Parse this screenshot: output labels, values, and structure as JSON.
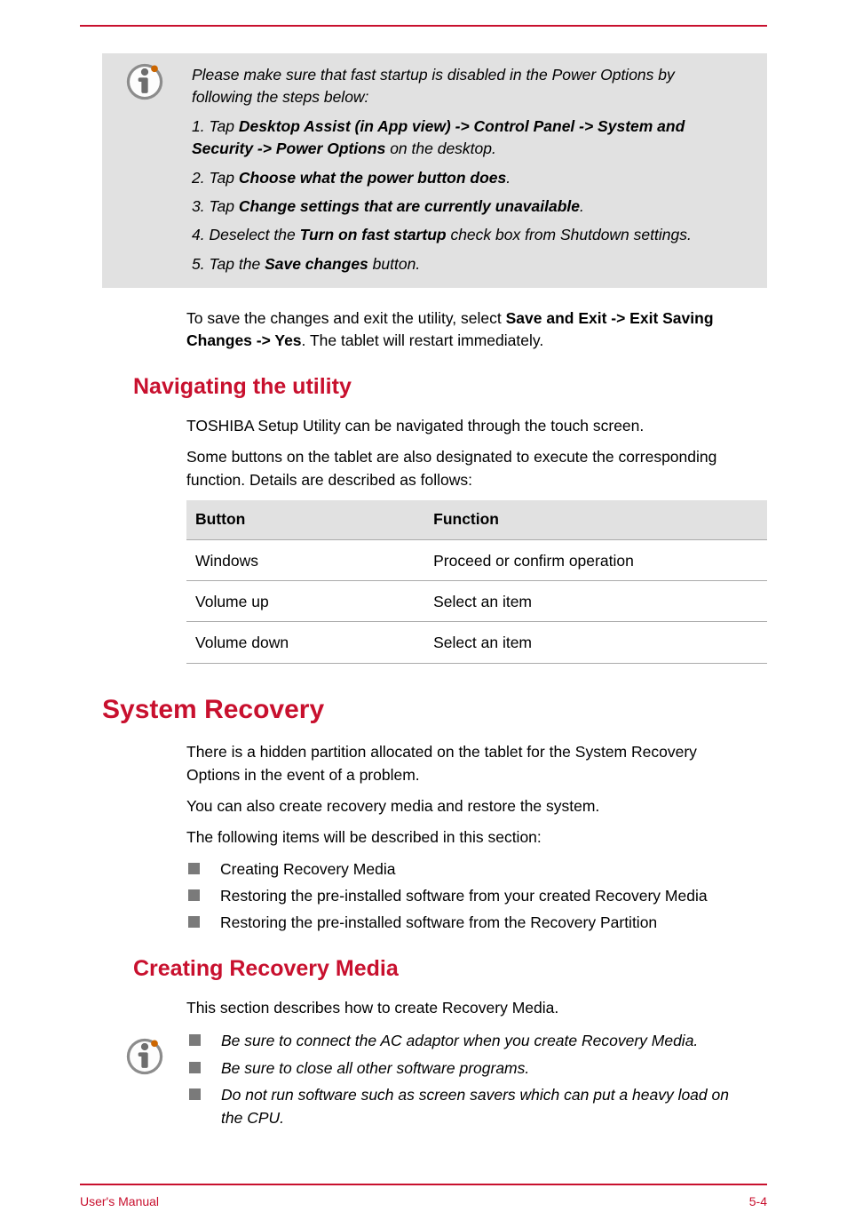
{
  "note1": {
    "intro": "Please make sure that fast startup is disabled in the Power Options by following the steps below:",
    "step1_pre": "1. Tap ",
    "step1_bold": "Desktop Assist (in App view) -> Control Panel -> System and Security -> Power Options",
    "step1_post": " on the desktop.",
    "step2_pre": "2. Tap ",
    "step2_bold": "Choose what the power button does",
    "step2_post": ".",
    "step3_pre": "3. Tap ",
    "step3_bold": "Change settings that are currently unavailable",
    "step3_post": ".",
    "step4_pre": "4. Deselect the ",
    "step4_bold": "Turn on fast startup",
    "step4_post": " check box from Shutdown settings.",
    "step5_pre": "5. Tap the ",
    "step5_bold": "Save changes",
    "step5_post": " button."
  },
  "save_exit": {
    "pre": "To save the changes and exit the utility, select ",
    "bold1": "Save and Exit -> Exit Saving Changes -> Yes",
    "post": ". The tablet will restart immediately."
  },
  "nav": {
    "heading": "Navigating the utility",
    "p1": "TOSHIBA Setup Utility can be navigated through the touch screen.",
    "p2": "Some buttons on the tablet are also designated to execute the corresponding function. Details are described as follows:"
  },
  "table": {
    "h1": "Button",
    "h2": "Function",
    "r1c1": "Windows",
    "r1c2": "Proceed or confirm operation",
    "r2c1": "Volume up",
    "r2c2": "Select an item",
    "r3c1": "Volume down",
    "r3c2": "Select an item"
  },
  "recovery": {
    "heading": "System Recovery",
    "p1": "There is a hidden partition allocated on the tablet for the System Recovery Options in the event of a problem.",
    "p2": "You can also create recovery media and restore the system.",
    "p3": "The following items will be described in this section:",
    "li1": "Creating Recovery Media",
    "li2": "Restoring the pre-installed software from your created Recovery Media",
    "li3": "Restoring the pre-installed software from the Recovery Partition"
  },
  "creating": {
    "heading": "Creating Recovery Media",
    "p1": "This section describes how to create Recovery Media."
  },
  "note2": {
    "li1": "Be sure to connect the AC adaptor when you create Recovery Media.",
    "li2": "Be sure to close all other software programs.",
    "li3": "Do not run software such as screen savers which can put a heavy load on the CPU."
  },
  "footer": {
    "left": "User's Manual",
    "right": "5-4"
  }
}
